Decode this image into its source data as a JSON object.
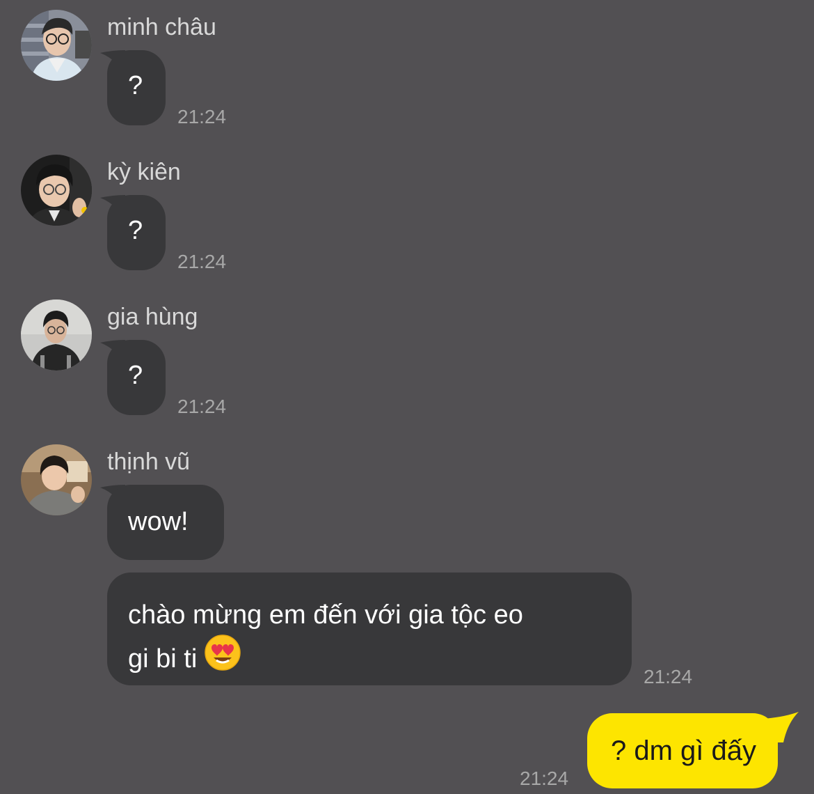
{
  "messages": [
    {
      "sender": "minh châu",
      "avatar_icon": "avatar-photo-icon",
      "text": "?",
      "time": "21:24"
    },
    {
      "sender": "kỳ kiên",
      "avatar_icon": "avatar-photo-icon",
      "text": "?",
      "time": "21:24"
    },
    {
      "sender": "gia hùng",
      "avatar_icon": "avatar-photo-icon",
      "text": "?",
      "time": "21:24"
    },
    {
      "sender": "thịnh vũ",
      "avatar_icon": "avatar-photo-icon",
      "text": "wow!",
      "text2_line1": "chào mừng em đến với gia tộc eo",
      "text2_line2": "gi bi ti",
      "emoji": "heart-eyes-emoji-icon",
      "time": "21:24"
    }
  ],
  "my_message": {
    "text": "? dm gì đấy",
    "time": "21:24"
  },
  "colors": {
    "background": "#525053",
    "incoming_bubble": "#38383a",
    "outgoing_bubble": "#fde500",
    "timestamp": "#a8a8a8"
  }
}
